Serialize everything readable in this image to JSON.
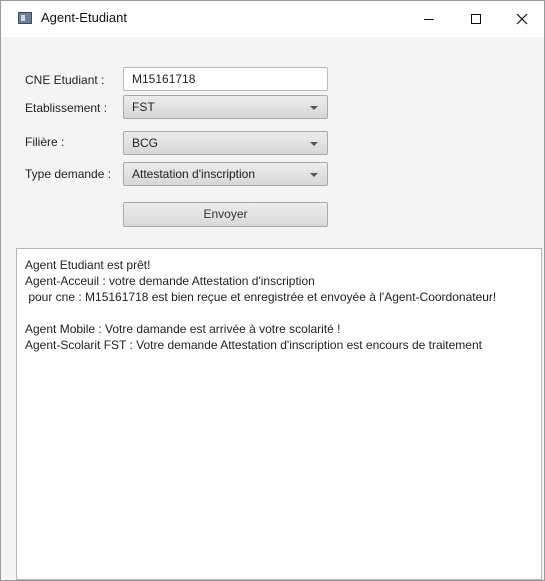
{
  "window": {
    "title": "Agent-Etudiant",
    "icon": "app-window-icon",
    "controls": [
      "minimize-icon",
      "maximize-icon",
      "close-icon"
    ]
  },
  "form": {
    "cne_label": "CNE Etudiant :",
    "cne_value": "M15161718",
    "etablissement_label": "Etablissement :",
    "etablissement_value": "FST",
    "filiere_label": "Filière :",
    "filiere_value": "BCG",
    "type_label": "Type demande :",
    "type_value": "Attestation d'inscription",
    "send_label": "Envoyer"
  },
  "log": {
    "lines": [
      "Agent Etudiant est prêt!",
      "Agent-Acceuil : votre demande Attestation d'inscription",
      " pour cne : M15161718 est bien reçue et enregistrée et envoyée à l'Agent-Coordonateur!",
      "",
      "Agent Mobile : Votre damande est arrivée à votre scolarité !",
      "Agent-Scolarit FST : Votre demande Attestation d'inscription est encours de traitement"
    ]
  }
}
